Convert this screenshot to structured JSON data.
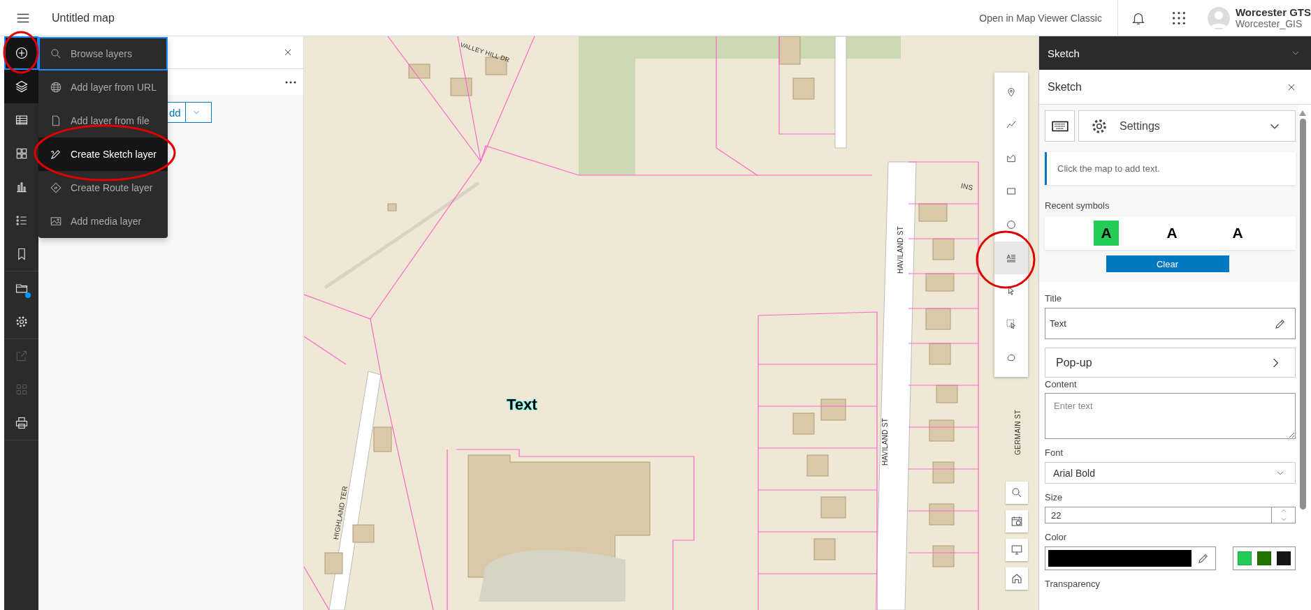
{
  "top_bar": {
    "title": "Untitled map",
    "link": "Open in Map Viewer Classic",
    "user": {
      "name": "Worcester GTS",
      "username": "Worcester_GIS"
    }
  },
  "left_rail": {
    "groups": [
      {
        "items": [
          {
            "kind": "add",
            "selected": true,
            "focused": true,
            "disabled": false,
            "badge": false
          },
          {
            "kind": "layers",
            "selected": true,
            "focused": false,
            "disabled": false,
            "badge": false
          },
          {
            "kind": "table",
            "selected": false,
            "focused": false,
            "disabled": false,
            "badge": false
          },
          {
            "kind": "grid",
            "selected": false,
            "focused": false,
            "disabled": false,
            "badge": false
          },
          {
            "kind": "chart",
            "selected": false,
            "focused": false,
            "disabled": false,
            "badge": false
          },
          {
            "kind": "legend",
            "selected": false,
            "focused": false,
            "disabled": false,
            "badge": false
          },
          {
            "kind": "bookmark",
            "selected": false,
            "focused": false,
            "disabled": false,
            "badge": false
          }
        ]
      },
      {
        "items": [
          {
            "kind": "folder",
            "selected": false,
            "focused": false,
            "disabled": false,
            "badge": true
          },
          {
            "kind": "gear",
            "selected": false,
            "focused": false,
            "disabled": false,
            "badge": false
          }
        ]
      },
      {
        "items": [
          {
            "kind": "share",
            "selected": false,
            "focused": false,
            "disabled": true,
            "badge": false
          },
          {
            "kind": "apps",
            "selected": false,
            "focused": false,
            "disabled": true,
            "badge": false
          },
          {
            "kind": "print",
            "selected": false,
            "focused": false,
            "disabled": false,
            "badge": false
          }
        ]
      }
    ]
  },
  "add_menu": {
    "items": [
      {
        "kind": "search",
        "label": "Browse layers",
        "focused": true,
        "selected": false
      },
      {
        "kind": "globe",
        "label": "Add layer from URL",
        "focused": false,
        "selected": false
      },
      {
        "kind": "file",
        "label": "Add layer from file",
        "focused": false,
        "selected": false
      },
      {
        "kind": "pen",
        "label": "Create Sketch layer",
        "focused": false,
        "selected": true
      },
      {
        "kind": "route",
        "label": "Create Route layer",
        "focused": false,
        "selected": false
      },
      {
        "kind": "image",
        "label": "Add media layer",
        "focused": false,
        "selected": false
      }
    ]
  },
  "layers_panel": {
    "add_button": "dd"
  },
  "map": {
    "road_labels": [
      {
        "text": "VALLEY HILL DR",
        "kind": "tilted"
      },
      {
        "text": "HAVILAND ST",
        "kind": "vertical"
      },
      {
        "text": "HAVILAND ST",
        "kind": "vertical"
      },
      {
        "text": "INS",
        "kind": "slanted"
      },
      {
        "text": "GERMAIN ST",
        "kind": "vertical"
      },
      {
        "text": "HIGHLAND TER",
        "kind": "steep"
      }
    ],
    "sketch_text": "Text"
  },
  "sketch_toolbar": {
    "tools": [
      {
        "kind": "point",
        "selected": false
      },
      {
        "kind": "polyline",
        "selected": false
      },
      {
        "kind": "polygon",
        "selected": false
      },
      {
        "kind": "rectangle",
        "selected": false
      },
      {
        "kind": "circle",
        "selected": false
      },
      {
        "kind": "text",
        "selected": true
      },
      {
        "kind": "select",
        "selected": false
      },
      {
        "kind": "select-area",
        "selected": false
      },
      {
        "kind": "lasso",
        "selected": false
      }
    ]
  },
  "map_controls": [
    {
      "kind": "search"
    },
    {
      "kind": "basemap"
    },
    {
      "kind": "monitor"
    },
    {
      "kind": "home"
    }
  ],
  "sketch_panel": {
    "header": "Sketch",
    "title": "Sketch",
    "settings": "Settings",
    "notice": "Click the map to add text.",
    "recent_label": "Recent symbols",
    "symbols": [
      {
        "glyph": "A",
        "selected": true
      },
      {
        "glyph": "A",
        "selected": false
      },
      {
        "glyph": "A",
        "selected": false
      }
    ],
    "clear_button": "Clear",
    "title_label": "Title",
    "title_value": "Text",
    "popup": "Pop-up",
    "content_label": "Content",
    "content_placeholder": "Enter text",
    "font_label": "Font",
    "font_value": "Arial Bold",
    "size_label": "Size",
    "size_value": "22",
    "color_label": "Color",
    "color": "#000000",
    "swatches": [
      {
        "color": "#22cc55"
      },
      {
        "color": "#267300"
      },
      {
        "color": "#151515"
      }
    ],
    "transparency_label": "Transparency"
  }
}
